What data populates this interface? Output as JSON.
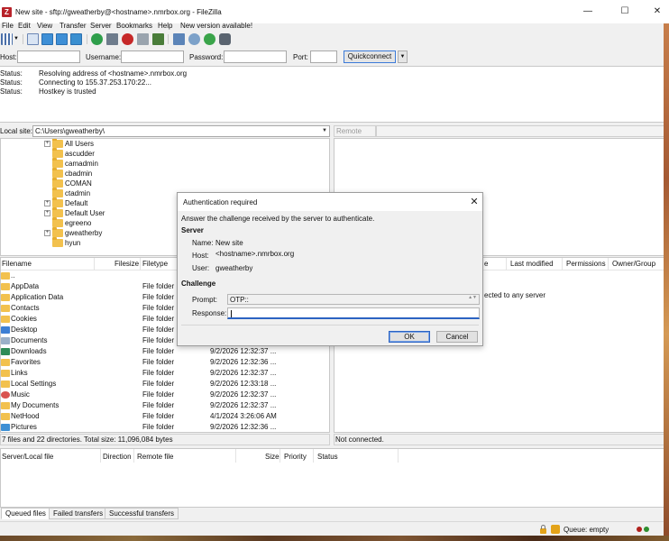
{
  "window": {
    "title": "New site - sftp://gweatherby@<hostname>.nmrbox.org - FileZilla",
    "app_icon_letter": "Z",
    "minimize": "—",
    "maximize": "☐",
    "close": "✕"
  },
  "menu": [
    "File",
    "Edit",
    "View",
    "Transfer",
    "Server",
    "Bookmarks",
    "Help",
    "New version available!"
  ],
  "quickconnect": {
    "host_label": "Host:",
    "username_label": "Username:",
    "password_label": "Password:",
    "port_label": "Port:",
    "button": "Quickconnect",
    "dropdown": "▼"
  },
  "log": [
    {
      "label": "Status:",
      "message": "Resolving address of <hostname>.nmrbox.org"
    },
    {
      "label": "Status:",
      "message": "Connecting to 155.37.253.170:22..."
    },
    {
      "label": "Status:",
      "message": "Hostkey is trusted"
    }
  ],
  "local": {
    "label": "Local site:",
    "path": "C:\\Users\\gweatherby\\",
    "arrow": "▼",
    "tree": [
      {
        "label": "All Users",
        "expand": true
      },
      {
        "label": "ascudder",
        "expand": false
      },
      {
        "label": "camadmin",
        "expand": false
      },
      {
        "label": "cbadmin",
        "expand": false
      },
      {
        "label": "COMAN",
        "expand": false
      },
      {
        "label": "ctadmin",
        "expand": false
      },
      {
        "label": "Default",
        "expand": true
      },
      {
        "label": "Default User",
        "expand": true
      },
      {
        "label": "egreeno",
        "expand": false
      },
      {
        "label": "gweatherby",
        "expand": true
      },
      {
        "label": "hyun",
        "expand": false
      }
    ],
    "expander_glyph": "+",
    "columns": {
      "filename": "Filename",
      "filesize": "Filesize",
      "filetype": "Filetype"
    },
    "files": [
      {
        "name": "..",
        "type": "",
        "modified": ""
      },
      {
        "name": "AppData",
        "type": "File folder",
        "modified": ""
      },
      {
        "name": "Application Data",
        "type": "File folder",
        "modified": ""
      },
      {
        "name": "Contacts",
        "type": "File folder",
        "modified": ""
      },
      {
        "name": "Cookies",
        "type": "File folder",
        "modified": ""
      },
      {
        "name": "Desktop",
        "type": "File folder",
        "modified": ""
      },
      {
        "name": "Documents",
        "type": "File folder",
        "modified": ""
      },
      {
        "name": "Downloads",
        "type": "File folder",
        "modified": "9/2/2026 12:32:37 ..."
      },
      {
        "name": "Favorites",
        "type": "File folder",
        "modified": "9/2/2026 12:32:36 ..."
      },
      {
        "name": "Links",
        "type": "File folder",
        "modified": "9/2/2026 12:32:37 ..."
      },
      {
        "name": "Local Settings",
        "type": "File folder",
        "modified": "9/2/2026 12:33:18 ..."
      },
      {
        "name": "Music",
        "type": "File folder",
        "modified": "9/2/2026 12:32:37 ..."
      },
      {
        "name": "My Documents",
        "type": "File folder",
        "modified": "9/2/2026 12:32:37 ..."
      },
      {
        "name": "NetHood",
        "type": "File folder",
        "modified": "4/1/2024 3:26:06 AM"
      },
      {
        "name": "Pictures",
        "type": "File folder",
        "modified": "9/2/2026 12:32:36 ..."
      }
    ],
    "status": "7 files and 22 directories. Total size: 11,096,084 bytes"
  },
  "remote": {
    "label": "Remote site:",
    "columns": {
      "type": "e",
      "last_modified": "Last modified",
      "permissions": "Permissions",
      "owner": "Owner/Group"
    },
    "empty_message": "ected to any server",
    "status": "Not connected."
  },
  "queue": {
    "columns": {
      "server": "Server/Local file",
      "direction": "Direction",
      "remote": "Remote file",
      "size": "Size",
      "priority": "Priority",
      "status": "Status"
    },
    "tabs": [
      "Queued files",
      "Failed transfers",
      "Successful transfers"
    ],
    "status": "Queue: empty"
  },
  "dialog": {
    "title": "Authentication required",
    "close": "✕",
    "intro": "Answer the challenge received by the server to authenticate.",
    "server_heading": "Server",
    "name_label": "Name:",
    "name_value": "New site",
    "host_label": "Host:",
    "host_value": "<hostname>.nmrbox.org",
    "user_label": "User:",
    "user_value": "gweatherby",
    "challenge_heading": "Challenge",
    "prompt_label": "Prompt:",
    "prompt_value": "OTP::",
    "response_label": "Response:",
    "response_value": "",
    "ok": "OK",
    "cancel": "Cancel"
  },
  "colors": {
    "accent": "#2b63c2",
    "folder": "#f2c14e",
    "app_icon": "#b8232a"
  }
}
